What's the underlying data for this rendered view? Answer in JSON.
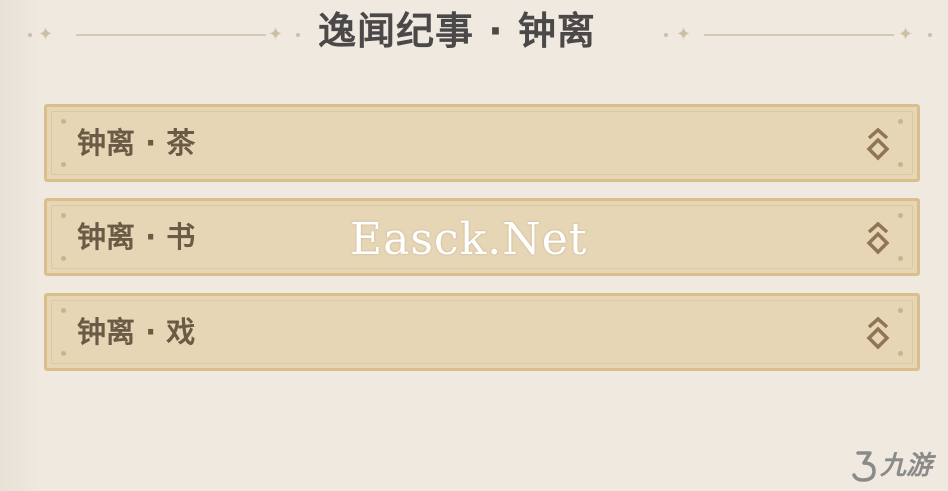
{
  "header": {
    "title": "逸闻纪事 · 钟离"
  },
  "items": [
    {
      "label": "钟离 · 茶",
      "icon": "expand-chevron-icon"
    },
    {
      "label": "钟离 · 书",
      "icon": "expand-chevron-icon"
    },
    {
      "label": "钟离 · 戏",
      "icon": "expand-chevron-icon"
    }
  ],
  "watermark": {
    "text": "Easck.Net"
  },
  "logo": {
    "text": "九游"
  },
  "colors": {
    "background": "#efe9df",
    "card_fill": "#e7d6b5",
    "card_border": "#d9bf8d",
    "title_text": "#4a4848",
    "label_text": "#6b5a45",
    "icon": "#8f7556"
  }
}
